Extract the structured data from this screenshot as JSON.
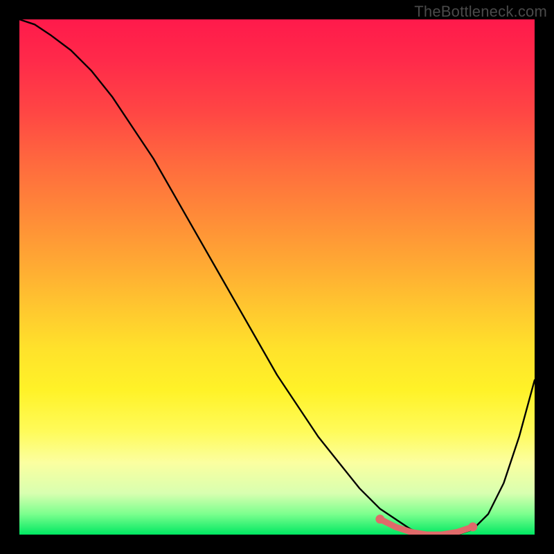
{
  "watermark": "TheBottleneck.com",
  "chart_data": {
    "type": "line",
    "title": "",
    "xlabel": "",
    "ylabel": "",
    "xlim": [
      0,
      100
    ],
    "ylim": [
      0,
      100
    ],
    "grid": false,
    "series": [
      {
        "name": "curve",
        "x": [
          0,
          3,
          6,
          10,
          14,
          18,
          22,
          26,
          30,
          34,
          38,
          42,
          46,
          50,
          54,
          58,
          62,
          66,
          70,
          73,
          76,
          79,
          82,
          85,
          88,
          91,
          94,
          97,
          100
        ],
        "y": [
          100,
          99,
          97,
          94,
          90,
          85,
          79,
          73,
          66,
          59,
          52,
          45,
          38,
          31,
          25,
          19,
          14,
          9,
          5,
          3,
          1,
          0,
          0,
          0,
          1,
          4,
          10,
          19,
          30
        ]
      },
      {
        "name": "highlight-band",
        "x": [
          70,
          73,
          76,
          79,
          82,
          85,
          88
        ],
        "y": [
          3,
          1.5,
          0.5,
          0,
          0,
          0.5,
          1.5
        ]
      }
    ],
    "colors": {
      "curve": "#000000",
      "highlight": "#e06a6a",
      "gradient_top": "#ff1a4b",
      "gradient_bottom": "#00e862"
    }
  }
}
